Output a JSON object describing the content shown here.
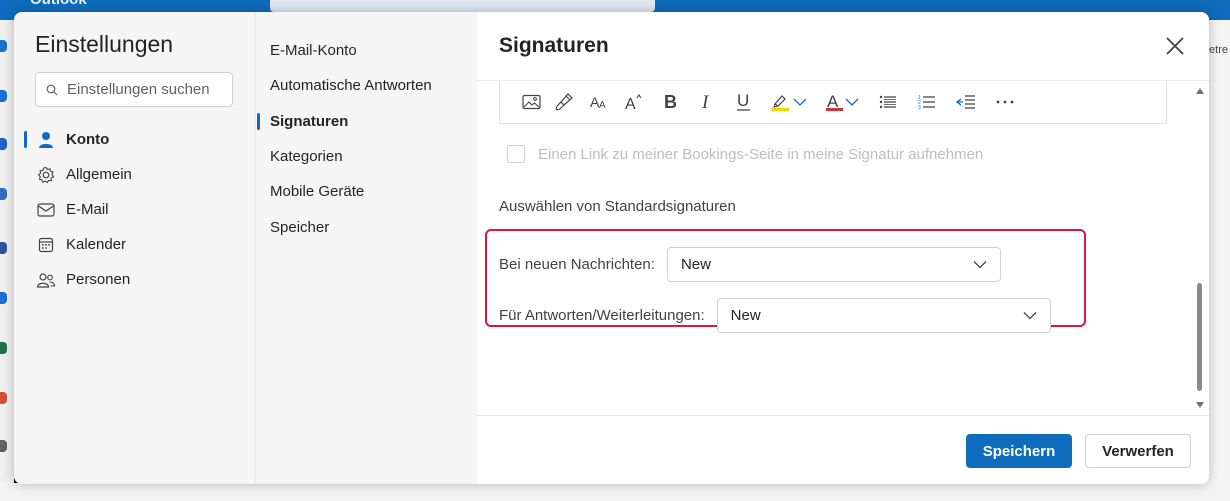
{
  "background_app": {
    "app_name": "Outlook",
    "right_edge_text": "etre"
  },
  "nav": {
    "title": "Einstellungen",
    "search_placeholder": "Einstellungen suchen",
    "items": [
      {
        "label": "Konto",
        "icon": "person-icon",
        "active": true
      },
      {
        "label": "Allgemein",
        "icon": "gear-icon",
        "active": false
      },
      {
        "label": "E-Mail",
        "icon": "mail-icon",
        "active": false
      },
      {
        "label": "Kalender",
        "icon": "calendar-icon",
        "active": false
      },
      {
        "label": "Personen",
        "icon": "people-icon",
        "active": false
      }
    ]
  },
  "subnav": {
    "items": [
      {
        "label": "E-Mail-Konto",
        "active": false
      },
      {
        "label": "Automatische Antworten",
        "active": false
      },
      {
        "label": "Signaturen",
        "active": true
      },
      {
        "label": "Kategorien",
        "active": false
      },
      {
        "label": "Mobile Geräte",
        "active": false
      },
      {
        "label": "Speicher",
        "active": false
      }
    ]
  },
  "main": {
    "title": "Signaturen",
    "toolbar": [
      {
        "name": "insert-picture",
        "icon": "picture-icon"
      },
      {
        "name": "format-painter",
        "icon": "paintbrush-icon"
      },
      {
        "name": "font-size",
        "icon": "font-size-icon"
      },
      {
        "name": "increase-font",
        "icon": "increase-font-icon"
      },
      {
        "name": "bold",
        "icon": "bold-icon"
      },
      {
        "name": "italic",
        "icon": "italic-icon"
      },
      {
        "name": "underline",
        "icon": "underline-icon"
      },
      {
        "name": "highlight",
        "icon": "highlighter-icon"
      },
      {
        "name": "font-color",
        "icon": "font-color-icon"
      },
      {
        "name": "bullets",
        "icon": "bullet-list-icon"
      },
      {
        "name": "numbering",
        "icon": "numbered-list-icon"
      },
      {
        "name": "decrease-indent",
        "icon": "decrease-indent-icon"
      },
      {
        "name": "more",
        "icon": "more-icon"
      }
    ],
    "colors": {
      "highlight": "#f2d600",
      "font_color": "#d13438",
      "accent": "#0f6cbd",
      "emphasis_box": "#e0143c"
    },
    "bookings_checkbox": {
      "label": "Einen Link zu meiner Bookings-Seite in meine Signatur aufnehmen",
      "checked": false,
      "disabled": true
    },
    "default_signatures": {
      "heading": "Auswählen von Standardsignaturen",
      "new_messages_label": "Bei neuen Nachrichten:",
      "new_messages_value": "New",
      "replies_label": "Für Antworten/Weiterleitungen:",
      "replies_value": "New"
    }
  },
  "footer": {
    "save_label": "Speichern",
    "discard_label": "Verwerfen"
  }
}
